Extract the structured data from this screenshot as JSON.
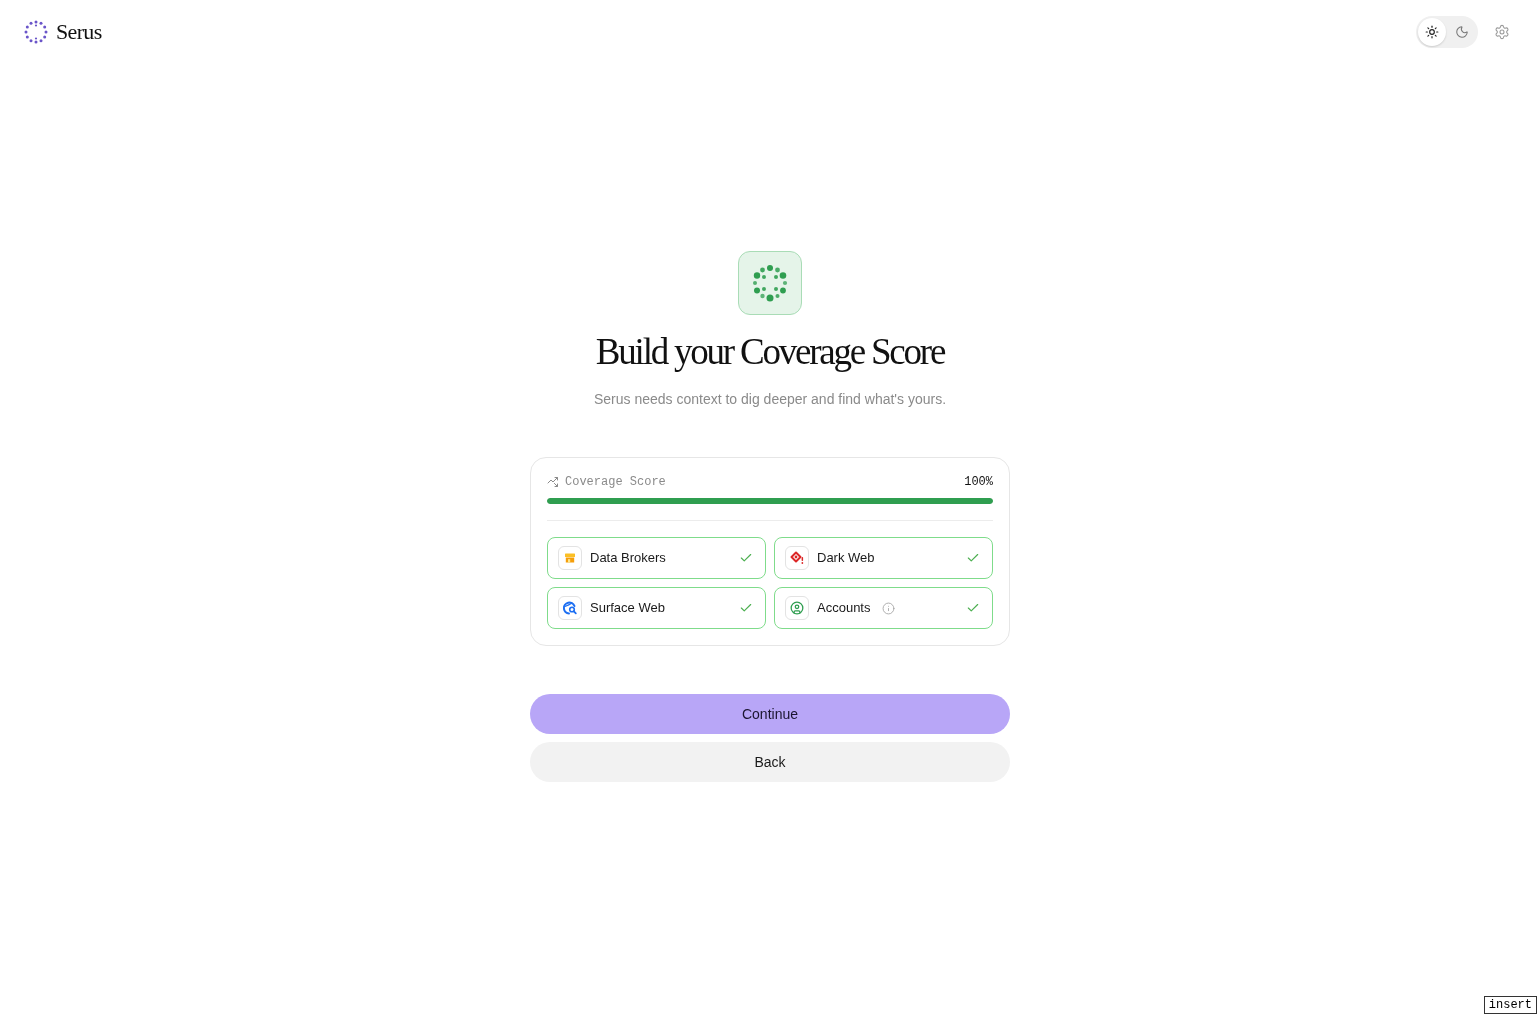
{
  "header": {
    "logo_text": "Serus",
    "theme_toggle": [
      {
        "kind": "light",
        "selected": true
      },
      {
        "kind": "dark",
        "selected": false
      }
    ]
  },
  "hero": {
    "title": "Build your Coverage Score",
    "subtitle": "Serus needs context to dig deeper and find what's yours."
  },
  "coverage": {
    "label": "Coverage Score",
    "value": "100%",
    "level": 1,
    "sources": [
      {
        "kind": "data_brokers",
        "label": "Data Brokers",
        "checked": true,
        "info": false
      },
      {
        "kind": "dark_web",
        "label": "Dark Web",
        "checked": true,
        "info": false
      },
      {
        "kind": "surface_web",
        "label": "Surface Web",
        "checked": true,
        "info": false
      },
      {
        "kind": "accounts",
        "label": "Accounts",
        "checked": true,
        "info": true
      }
    ]
  },
  "buttons": [
    {
      "kind": "primary",
      "label": "Continue"
    },
    {
      "kind": "secondary",
      "label": "Back"
    }
  ],
  "mode_indicator": "insert"
}
